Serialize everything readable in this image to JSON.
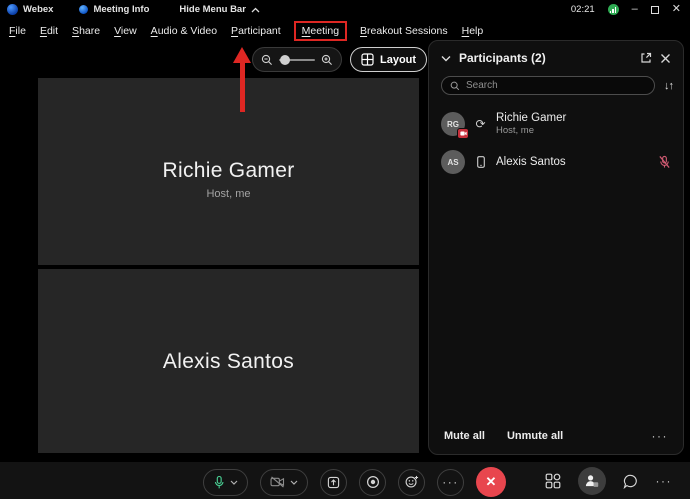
{
  "colors": {
    "annotation_red": "#de2723",
    "mic_green": "#4ad295",
    "leave_red": "#e8464e",
    "muted_mic_red": "#cf5a72",
    "status_green": "#2fab53",
    "tile_bg": "#262626",
    "panel_bg": "#0f0f0f"
  },
  "titlebar": {
    "app_name": "Webex",
    "meeting_info_label": "Meeting Info",
    "hide_menu_bar_label": "Hide Menu Bar",
    "time": "02:21"
  },
  "icons": {
    "minimize": "–",
    "close": "✕",
    "ellipsis": "···",
    "sort": "↓↑",
    "sync": "⟳",
    "leave_x": "✕"
  },
  "menubar": {
    "items": [
      {
        "label": "File"
      },
      {
        "label": "Edit"
      },
      {
        "label": "Share"
      },
      {
        "label": "View"
      },
      {
        "label": "Audio & Video"
      },
      {
        "label": "Participant"
      },
      {
        "label": "Meeting",
        "highlighted": true
      },
      {
        "label": "Breakout Sessions"
      },
      {
        "label": "Help"
      }
    ]
  },
  "top_controls": {
    "layout_label": "Layout"
  },
  "stage": {
    "tiles": [
      {
        "name": "Richie Gamer",
        "subtitle": "Host, me"
      },
      {
        "name": "Alexis Santos"
      }
    ]
  },
  "participants_panel": {
    "title": "Participants (2)",
    "search_placeholder": "Search",
    "rows": [
      {
        "initials": "RG",
        "name": "Richie Gamer",
        "subtitle": "Host, me",
        "camera_off_badge": true,
        "device": "paired-device"
      },
      {
        "initials": "AS",
        "name": "Alexis Santos",
        "device": "mobile",
        "muted": true
      }
    ],
    "mute_all_label": "Mute all",
    "unmute_all_label": "Unmute all"
  }
}
